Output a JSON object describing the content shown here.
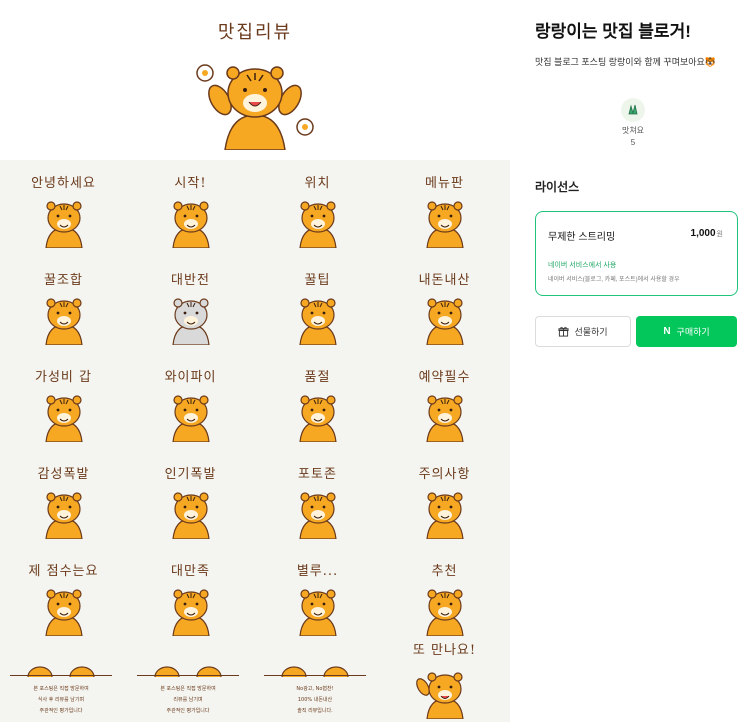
{
  "hero": {
    "title": "맛집리뷰"
  },
  "stickers": [
    {
      "label": "안녕하세요",
      "icon": "tiger-hands-up-icon"
    },
    {
      "label": "시작!",
      "icon": "tiger-point-icon"
    },
    {
      "label": "위치",
      "icon": "tiger-location-pin-icon"
    },
    {
      "label": "메뉴판",
      "icon": "tiger-menu-board-icon"
    },
    {
      "label": "꿀조합",
      "icon": "tiger-bee-icon"
    },
    {
      "label": "대반전",
      "icon": "tiger-shocked-white-icon"
    },
    {
      "label": "꿀팁",
      "icon": "tiger-honey-pot-icon"
    },
    {
      "label": "내돈내산",
      "icon": "tiger-card-sunglasses-icon"
    },
    {
      "label": "가성비 갑",
      "icon": "tiger-flowers-icon"
    },
    {
      "label": "와이파이",
      "icon": "tiger-wifi-icon"
    },
    {
      "label": "품절",
      "icon": "tiger-sold-out-icon"
    },
    {
      "label": "예약필수",
      "icon": "tiger-phone-icon"
    },
    {
      "label": "감성폭발",
      "icon": "tiger-hearts-icon"
    },
    {
      "label": "인기폭발",
      "icon": "tiger-crowd-icon"
    },
    {
      "label": "포토존",
      "icon": "tiger-sparkle-icon"
    },
    {
      "label": "주의사항",
      "icon": "tiger-flags-icon"
    },
    {
      "label": "제 점수는요",
      "icon": "tiger-microphone-icon"
    },
    {
      "label": "대만족",
      "icon": "tiger-happy-hearts-icon"
    },
    {
      "label": "별루...",
      "icon": "tiger-meh-face-icon"
    },
    {
      "label": "추천",
      "icon": "tiger-star-wave-icon"
    }
  ],
  "notes": [
    {
      "lines": [
        "본 포스팅은 직접 방문하여",
        "식사 후 리뷰를 남기며",
        "주관적인 평가입니다"
      ]
    },
    {
      "lines": [
        "본 포스팅은 직접 방문하여",
        "리뷰를 남기며",
        "주관적인 평가입니다"
      ]
    },
    {
      "lines": [
        "No광고, No협찬!",
        "100% 내돈내산",
        "솔직 리뷰입니다."
      ]
    }
  ],
  "last_sticker": {
    "label": "또 만나요!",
    "icon": "tiger-waving-bye-icon"
  },
  "product": {
    "title": "랑랑이는 맛집 블로거!",
    "description": "맛집 블로그 포스팅 랑랑이와 함께 꾸며보아요🐯",
    "tag_label": "맛쳐요",
    "tag_count": "5"
  },
  "license": {
    "heading": "라이선스",
    "name": "무제한 스트리밍",
    "price": "1,000",
    "currency": "원",
    "scope": "네이버 서비스에서 사용",
    "detail": "네이버 서비스(블로그, 카페, 포스트)에서 사용할 경우"
  },
  "buttons": {
    "gift": "선물하기",
    "buy": "구매하기",
    "buy_logo": "N"
  },
  "colors": {
    "accent_green": "#03c75a",
    "card_border": "#1fc37a",
    "tiger_orange": "#f7a823",
    "label_brown": "#6b3a1c"
  }
}
